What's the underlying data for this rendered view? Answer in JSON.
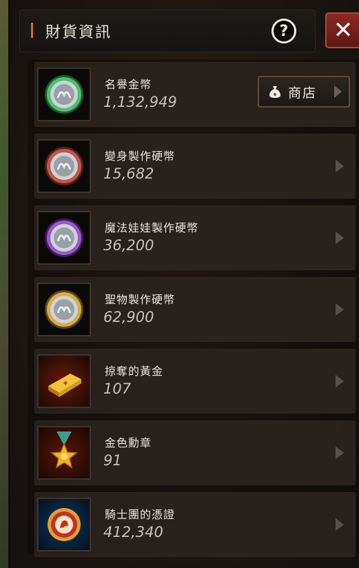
{
  "header": {
    "title": "財貨資訊"
  },
  "shop_button": {
    "label": "商店"
  },
  "currencies": [
    {
      "name": "名譽金幣",
      "value": "1,132,949",
      "icon": "silver-green-coin-icon",
      "color": "#3aa05a"
    },
    {
      "name": "變身製作硬幣",
      "value": "15,682",
      "icon": "silver-red-coin-icon",
      "color": "#b04a3c"
    },
    {
      "name": "魔法娃娃製作硬幣",
      "value": "36,200",
      "icon": "silver-purple-coin-icon",
      "color": "#8a4ab8"
    },
    {
      "name": "聖物製作硬幣",
      "value": "62,900",
      "icon": "silver-gold-coin-icon",
      "color": "#c99a3a"
    },
    {
      "name": "掠奪的黃金",
      "value": "107",
      "icon": "gold-bar-icon",
      "color": "#e0a22a"
    },
    {
      "name": "金色勳章",
      "value": "91",
      "icon": "gold-medal-icon",
      "color": "#e0a22a"
    },
    {
      "name": "騎士團的憑證",
      "value": "412,340",
      "icon": "knight-emblem-icon",
      "color": "#c0302a"
    }
  ]
}
